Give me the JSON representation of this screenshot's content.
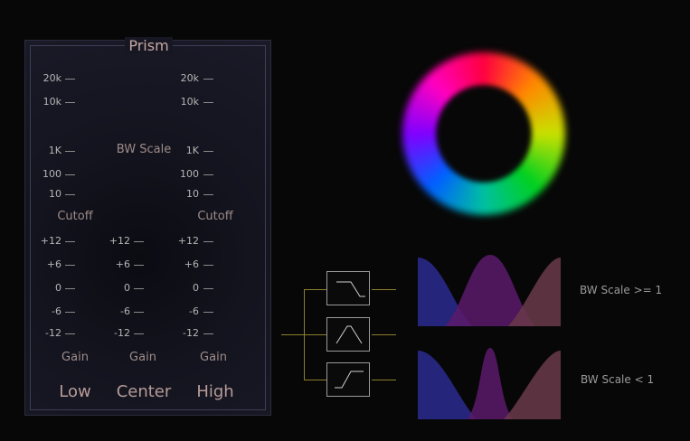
{
  "title": "Prism",
  "cutoff_ticks": [
    "20k",
    "10k",
    "1K",
    "100",
    "10"
  ],
  "gain_ticks": [
    "+12",
    "+6",
    "0",
    "-6",
    "-12"
  ],
  "labels": {
    "bw_scale": "BW Scale",
    "cutoff": "Cutoff",
    "gain": "Gain"
  },
  "bands": [
    "Low",
    "Center",
    "High"
  ],
  "filter_icons": [
    "lowpass-icon",
    "bandpass-icon",
    "highpass-icon"
  ],
  "plots": {
    "wide_label": "BW Scale >= 1",
    "narrow_label": "BW Scale < 1"
  },
  "colors": {
    "low_band": "#2a2a90",
    "center_band": "#5a1a6a",
    "high_band": "#6a3a4a",
    "wire": "#8a7f2e"
  }
}
